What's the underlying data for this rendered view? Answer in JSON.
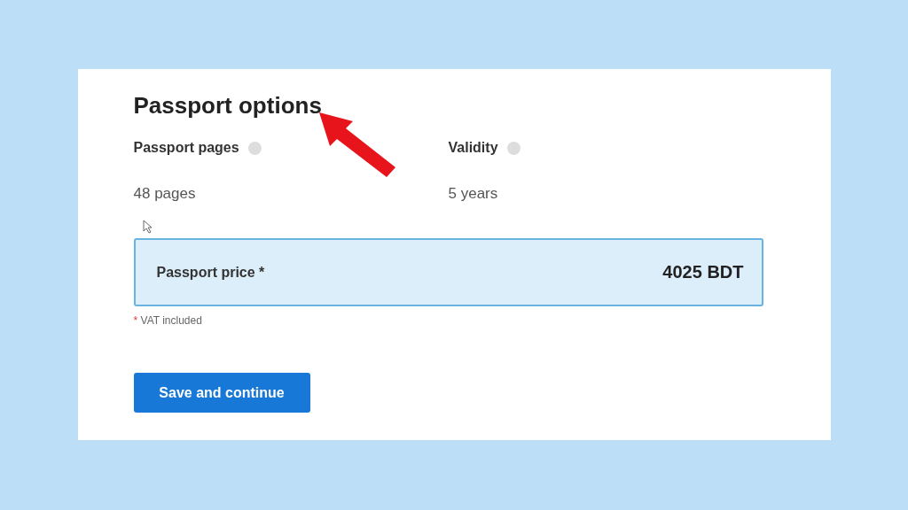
{
  "title": "Passport options",
  "fields": [
    {
      "label": "Passport pages",
      "value": "48 pages"
    },
    {
      "label": "Validity",
      "value": "5 years"
    }
  ],
  "price": {
    "label": "Passport price *",
    "value": "4025 BDT"
  },
  "note": {
    "mark": "*",
    "text": "VAT included"
  },
  "button": "Save and continue"
}
